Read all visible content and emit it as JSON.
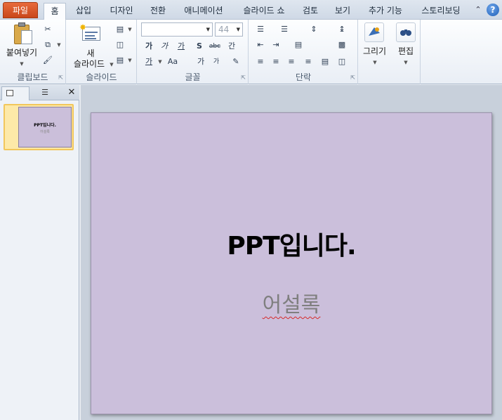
{
  "tabs": {
    "file": "파일",
    "home": "홈",
    "insert": "삽입",
    "design": "디자인",
    "transition": "전환",
    "animation": "애니메이션",
    "slideshow": "슬라이드 쇼",
    "review": "검토",
    "view": "보기",
    "addins": "추가 기능",
    "storyboard": "스토리보딩"
  },
  "ribbon": {
    "clipboard": {
      "label": "클립보드",
      "paste_label": "붙여넣기"
    },
    "slides": {
      "label": "슬라이드",
      "new_slide_line1": "새",
      "new_slide_line2": "슬라이드"
    },
    "font": {
      "label": "글꼴",
      "font_name": "",
      "font_size": "44",
      "bold": "가",
      "italic": "가",
      "underline": "가",
      "shadow": "S",
      "strike": "abc",
      "spacing": "간",
      "color": "가",
      "case": "Aa",
      "grow": "가",
      "shrink": "가"
    },
    "paragraph": {
      "label": "단락"
    },
    "drawing": {
      "label": "그리기"
    },
    "editing": {
      "label": "편집"
    }
  },
  "panel": {
    "slide_number": "1",
    "thumb_title": "PPT입니다.",
    "thumb_sub": "어설록"
  },
  "slide": {
    "title": "PPT입니다.",
    "subtitle": "어설록",
    "background": "#cbbfdb"
  },
  "icons": [
    "cut-icon",
    "copy-icon",
    "format-painter-icon",
    "layout-icon",
    "reset-icon",
    "section-icon",
    "bullets-icon",
    "numbering-icon",
    "line-spacing-icon",
    "columns-icon",
    "align-left-icon",
    "center-icon",
    "align-right-icon",
    "justify-icon",
    "shapes-icon",
    "find-icon",
    "help-icon"
  ]
}
